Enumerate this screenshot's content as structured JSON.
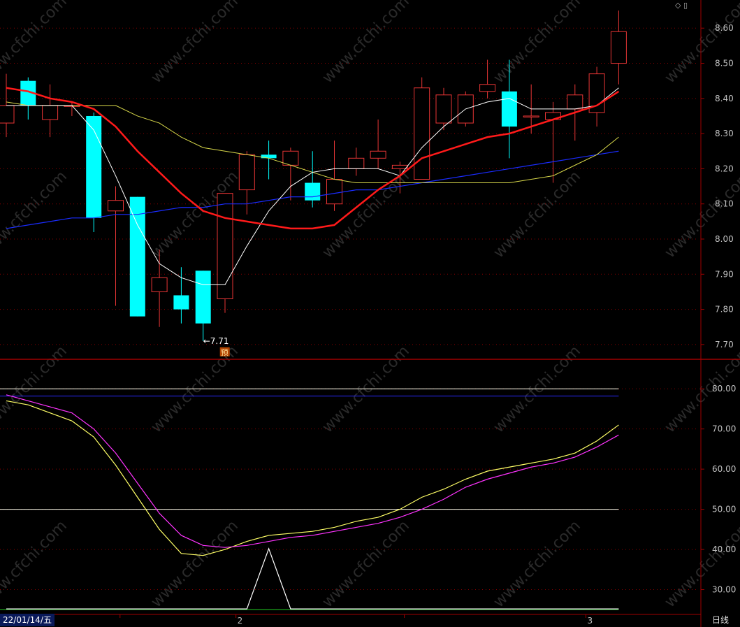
{
  "colors": {
    "up": "#e83535",
    "down": "#00ffff",
    "ma_white": "#ffffff",
    "ma_yellow": "#d8d84a",
    "ma_red": "#ff1a1a",
    "ma_blue": "#1a2cff",
    "kdj_yellow": "#ffff66",
    "kdj_magenta": "#ff33ff",
    "grid": "#8a0000",
    "axis": "#a00000"
  },
  "chart_data": [
    {
      "type": "candlestick",
      "ylim": [
        7.66,
        8.68
      ],
      "yticks": [
        "8.60",
        "8.50",
        "8.40",
        "8.30",
        "8.20",
        "8.10",
        "8.00",
        "7.90",
        "7.80",
        "7.70"
      ],
      "candles": [
        {
          "o": 8.33,
          "c": 8.38,
          "h": 8.47,
          "l": 8.29
        },
        {
          "o": 8.45,
          "c": 8.38,
          "h": 8.46,
          "l": 8.34
        },
        {
          "o": 8.34,
          "c": 8.38,
          "h": 8.44,
          "l": 8.29
        },
        {
          "o": 8.38,
          "c": 8.38,
          "h": 8.39,
          "l": 8.35
        },
        {
          "o": 8.35,
          "c": 8.06,
          "h": 8.36,
          "l": 8.02
        },
        {
          "o": 8.08,
          "c": 8.11,
          "h": 8.15,
          "l": 7.81
        },
        {
          "o": 8.12,
          "c": 7.78,
          "h": 8.12,
          "l": 7.78
        },
        {
          "o": 7.85,
          "c": 7.89,
          "h": 7.97,
          "l": 7.75
        },
        {
          "o": 7.84,
          "c": 7.8,
          "h": 7.92,
          "l": 7.76
        },
        {
          "o": 7.91,
          "c": 7.76,
          "h": 7.91,
          "l": 7.71
        },
        {
          "o": 7.83,
          "c": 8.13,
          "h": 8.13,
          "l": 7.79
        },
        {
          "o": 8.14,
          "c": 8.24,
          "h": 8.25,
          "l": 8.07
        },
        {
          "o": 8.24,
          "c": 8.23,
          "h": 8.28,
          "l": 8.17
        },
        {
          "o": 8.21,
          "c": 8.25,
          "h": 8.26,
          "l": 8.11
        },
        {
          "o": 8.16,
          "c": 8.11,
          "h": 8.25,
          "l": 8.09
        },
        {
          "o": 8.1,
          "c": 8.17,
          "h": 8.28,
          "l": 8.08
        },
        {
          "o": 8.2,
          "c": 8.23,
          "h": 8.26,
          "l": 8.18
        },
        {
          "o": 8.23,
          "c": 8.25,
          "h": 8.34,
          "l": 8.2
        },
        {
          "o": 8.2,
          "c": 8.21,
          "h": 8.22,
          "l": 8.13
        },
        {
          "o": 8.17,
          "c": 8.43,
          "h": 8.46,
          "l": 8.17
        },
        {
          "o": 8.33,
          "c": 8.41,
          "h": 8.43,
          "l": 8.31
        },
        {
          "o": 8.33,
          "c": 8.41,
          "h": 8.42,
          "l": 8.32
        },
        {
          "o": 8.42,
          "c": 8.44,
          "h": 8.51,
          "l": 8.4
        },
        {
          "o": 8.42,
          "c": 8.32,
          "h": 8.51,
          "l": 8.23
        },
        {
          "o": 8.35,
          "c": 8.35,
          "h": 8.44,
          "l": 8.3
        },
        {
          "o": 8.34,
          "c": 8.36,
          "h": 8.39,
          "l": 8.16
        },
        {
          "o": 8.37,
          "c": 8.41,
          "h": 8.44,
          "l": 8.28
        },
        {
          "o": 8.36,
          "c": 8.47,
          "h": 8.49,
          "l": 8.32
        },
        {
          "o": 8.5,
          "c": 8.59,
          "h": 8.65,
          "l": 8.44
        }
      ],
      "ma_white": [
        8.38,
        8.38,
        8.38,
        8.38,
        8.31,
        8.18,
        8.04,
        7.93,
        7.89,
        7.87,
        7.87,
        7.98,
        8.08,
        8.15,
        8.19,
        8.2,
        8.2,
        8.2,
        8.18,
        8.26,
        8.32,
        8.37,
        8.39,
        8.4,
        8.37,
        8.37,
        8.37,
        8.38,
        8.43
      ],
      "ma_yellow": [
        8.39,
        8.38,
        8.38,
        8.38,
        8.38,
        8.38,
        8.35,
        8.33,
        8.29,
        8.26,
        8.25,
        8.24,
        8.23,
        8.21,
        8.19,
        8.17,
        8.16,
        8.16,
        8.16,
        8.16,
        8.16,
        8.16,
        8.16,
        8.16,
        8.17,
        8.18,
        8.21,
        8.24,
        8.29
      ],
      "ma_red": [
        8.43,
        8.42,
        8.4,
        8.39,
        8.37,
        8.32,
        8.25,
        8.19,
        8.13,
        8.08,
        8.06,
        8.05,
        8.04,
        8.03,
        8.03,
        8.04,
        8.09,
        8.14,
        8.18,
        8.23,
        8.25,
        8.27,
        8.29,
        8.3,
        8.32,
        8.34,
        8.36,
        8.38,
        8.42
      ],
      "ma_blue": [
        8.03,
        8.04,
        8.05,
        8.06,
        8.06,
        8.07,
        8.07,
        8.08,
        8.09,
        8.09,
        8.1,
        8.1,
        8.11,
        8.12,
        8.12,
        8.13,
        8.14,
        8.14,
        8.15,
        8.16,
        8.17,
        8.18,
        8.19,
        8.2,
        8.21,
        8.22,
        8.23,
        8.24,
        8.25
      ],
      "low_annotation": {
        "text": "7.71",
        "badge": "预"
      }
    },
    {
      "type": "line",
      "ylim": [
        24,
        87
      ],
      "yticks": [
        "80.00",
        "70.00",
        "60.00",
        "50.00",
        "40.00",
        "30.00"
      ],
      "hlines": [
        {
          "y": 80,
          "color": "#ffffee"
        },
        {
          "y": 78.2,
          "color": "#2a2aff"
        },
        {
          "y": 50,
          "color": "#ffffee"
        }
      ],
      "series": [
        {
          "color": "#ffff66",
          "values": [
            77.0,
            76.0,
            74.0,
            72.0,
            68.0,
            61.0,
            53.0,
            45.0,
            39.0,
            38.5,
            40.0,
            42.0,
            43.5,
            44.0,
            44.5,
            45.5,
            47.0,
            48.0,
            50.0,
            53.0,
            55.0,
            57.5,
            59.5,
            60.5,
            61.5,
            62.5,
            64.0,
            67.0,
            71.0
          ]
        },
        {
          "color": "#ff33ff",
          "values": [
            78.5,
            77.0,
            75.5,
            74.0,
            70.0,
            64.0,
            56.5,
            49.0,
            43.5,
            41.0,
            40.5,
            41.0,
            42.0,
            43.0,
            43.5,
            44.5,
            45.5,
            46.5,
            48.0,
            50.0,
            52.5,
            55.5,
            57.5,
            59.0,
            60.5,
            61.5,
            63.0,
            65.5,
            68.5
          ]
        },
        {
          "color": "#ffffff",
          "values": [
            25.2,
            25.2,
            25.2,
            25.2,
            25.2,
            25.2,
            25.2,
            25.2,
            25.2,
            25.2,
            25.2,
            25.2,
            40.2,
            25.2,
            25.2,
            25.2,
            25.2,
            25.2,
            25.2,
            25.2,
            25.2,
            25.2,
            25.2,
            25.2,
            25.2,
            25.2,
            25.2,
            25.2,
            25.2
          ]
        }
      ]
    }
  ],
  "xaxis": {
    "date_label": "22/01/14/五",
    "month_labels": [
      "2",
      "3"
    ],
    "period": "日线"
  }
}
